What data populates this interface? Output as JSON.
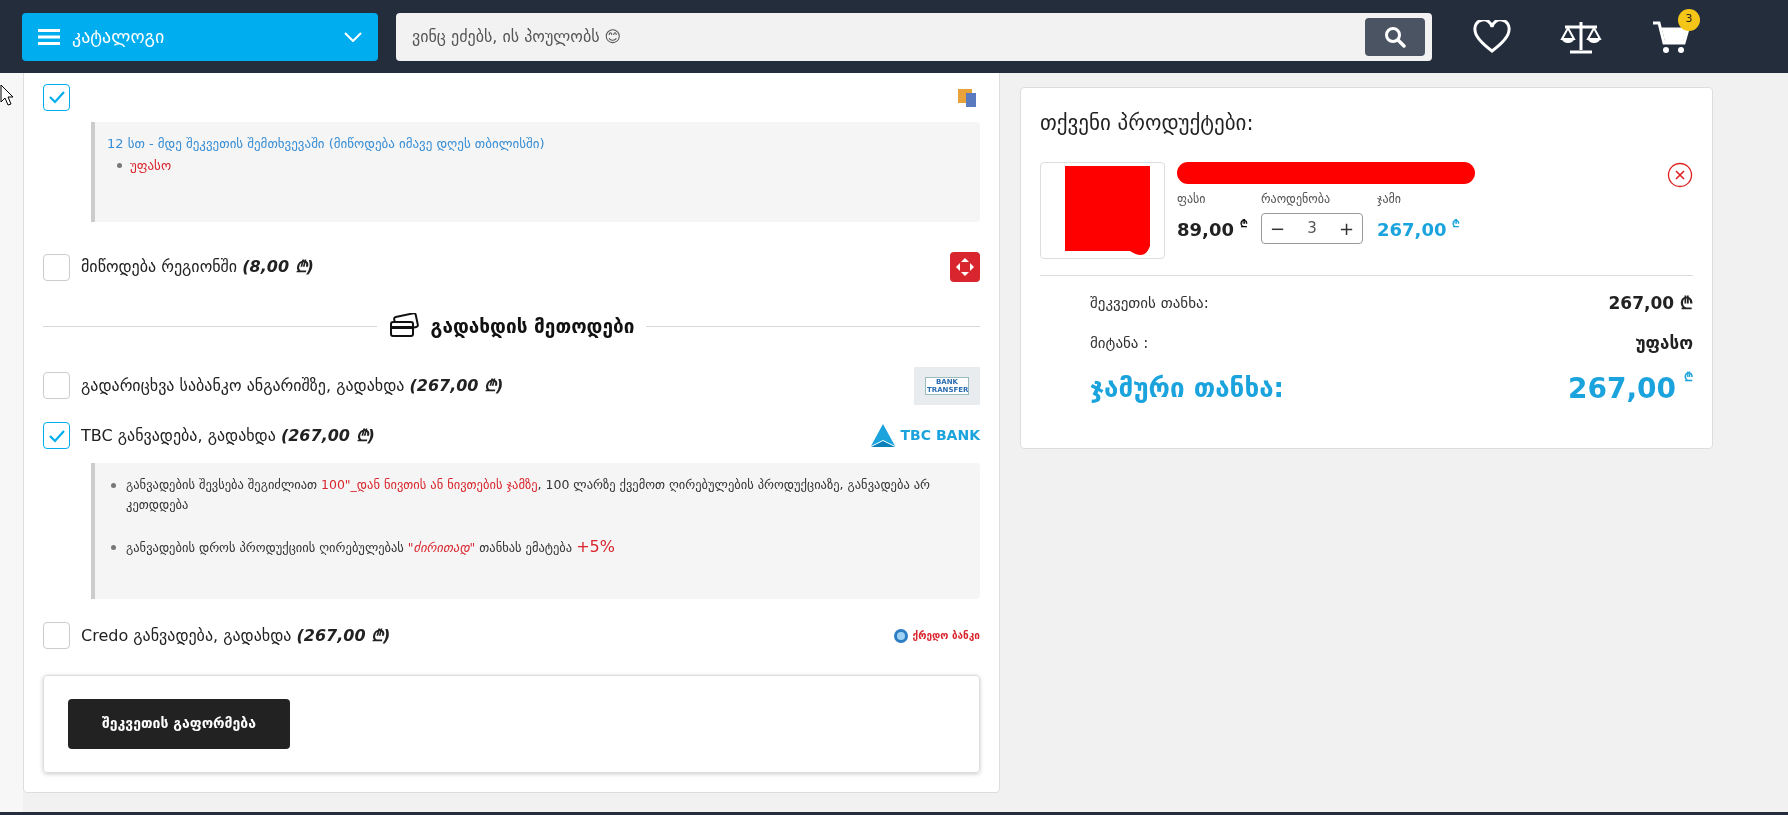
{
  "header": {
    "catalog_label": "კატალოგი",
    "search": {
      "placeholder": "ვინც ეძებს, ის პოულობს 😊"
    },
    "cart_count": "3"
  },
  "delivery": {
    "options": [
      {
        "checked": true,
        "logo": {
          "kind": "box"
        },
        "info": {
          "title": "12 სთ - მდე შეკვეთის შემთხვევაში (მიწოდება  იმავე დღეს თბილისში)",
          "bullets": [
            "უფასო"
          ]
        }
      },
      {
        "label": "მიწოდება რეგიონში",
        "price": "(8,00 ₾)",
        "checked": false,
        "logo": {
          "kind": "red"
        }
      }
    ]
  },
  "payment": {
    "heading": "გადახდის მეთოდები",
    "methods": [
      {
        "label": "გადარიცხვა საბანკო ანგარიშზე, გადახდა",
        "price": "(267,00 ₾)",
        "checked": false,
        "logo": {
          "kind": "bank",
          "text": "BANK TRANSFER"
        }
      },
      {
        "label": "TBC განვადება, გადახდა",
        "price": "(267,00 ₾)",
        "checked": true,
        "logo": {
          "kind": "tbc",
          "text": "TBC BANK"
        },
        "notes": [
          [
            {
              "text": "განვადების შევსება შეგიძლიათ ",
              "highlight": false
            },
            {
              "text": "100\"_დან ნივთის ან ნივთების ჯამზე",
              "highlight": true
            },
            {
              "text": ", 100 ლარზე ქვემოთ ღირებულების პროდუქციაზე, განვადება არ კეთდდება",
              "highlight": false
            }
          ],
          [
            {
              "text": "განვადების დროს პროდუქციის ღირებულებას ",
              "highlight": false
            },
            {
              "text": "\"ძირითად\"",
              "highlight": true,
              "italic": true
            },
            {
              "text": " თანხას ემატება ",
              "highlight": false
            },
            {
              "text": "+5%",
              "highlight": true,
              "large": true
            }
          ]
        ]
      },
      {
        "label": "Credo განვადება, გადახდა",
        "price": "(267,00 ₾)",
        "checked": false,
        "logo": {
          "kind": "credo",
          "text": "ქრედო ბანკი"
        }
      }
    ]
  },
  "submit_label": "შეკვეთის გაფორმება",
  "cart": {
    "title": "თქვენი პროდუქტები:",
    "items": [
      {
        "price_label": "ფასი",
        "price": "89,00",
        "currency": "₾",
        "qty_label": "რაოდენობა",
        "qty": "3",
        "minus": "−",
        "plus": "+",
        "sum_label": "ჯამი",
        "sum": "267,00",
        "sum_currency": "₾"
      }
    ],
    "summary": [
      {
        "label": "შეკვეთის თანხა:",
        "value": "267,00 ₾"
      },
      {
        "label": "მიტანა :",
        "value": "უფასო"
      }
    ],
    "total": {
      "label": "ჯამური თანხა:",
      "value": "267,00",
      "currency": "₾"
    }
  }
}
